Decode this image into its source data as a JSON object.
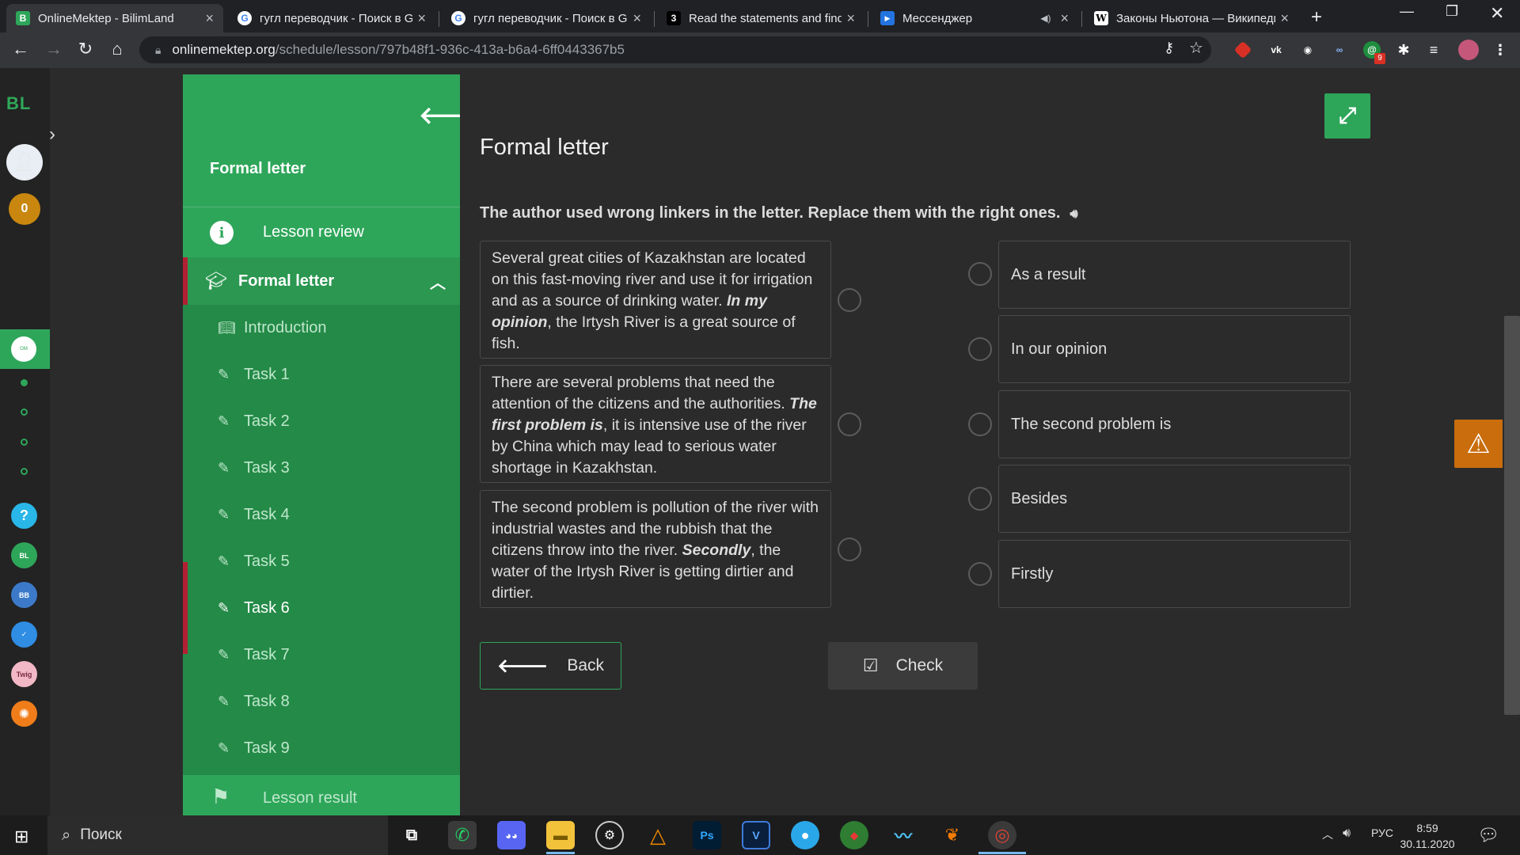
{
  "browser": {
    "tabs": [
      {
        "title": "OnlineMektep - BilimLand",
        "favicon": "B"
      },
      {
        "title": "гугл переводчик - Поиск в Google",
        "favicon": "G"
      },
      {
        "title": "гугл переводчик - Поиск в Google",
        "favicon": "G"
      },
      {
        "title": "Read the statements and find",
        "favicon": "3"
      },
      {
        "title": "Мессенджер",
        "favicon": "▶"
      },
      {
        "title": "Законы Ньютона — Википедия",
        "favicon": "W"
      }
    ],
    "url_domain": "onlinemektep.org",
    "url_path": "/schedule/lesson/797b48f1-936c-413a-b6a4-6ff0443367b5",
    "extension_badge": "9"
  },
  "rail": {
    "logo": "BL",
    "coins": "0"
  },
  "sidebar": {
    "title": "Formal letter",
    "review_label": "Lesson review",
    "section_label": "Formal letter",
    "items": [
      {
        "label": "Introduction"
      },
      {
        "label": "Task 1"
      },
      {
        "label": "Task 2"
      },
      {
        "label": "Task 3"
      },
      {
        "label": "Task 4"
      },
      {
        "label": "Task 5"
      },
      {
        "label": "Task 6"
      },
      {
        "label": "Task 7"
      },
      {
        "label": "Task 8"
      },
      {
        "label": "Task 9"
      }
    ],
    "result_label": "Lesson result"
  },
  "main": {
    "title": "Formal letter",
    "instruction": "The author used wrong linkers in the letter. Replace them with the right ones.",
    "left_items": [
      {
        "before": "Several great cities of Kazakhstan are located on this fast-moving river and use it for irrigation and as a source of drinking water. ",
        "emph": "In my opinion",
        "after": ", the Irtysh River is a great source of fish."
      },
      {
        "before": "There are several problems that need the attention of the citizens and the authorities. ",
        "emph": "The first problem is",
        "after": ", it is intensive use of the river by China which may lead to serious water shortage in Kazakhstan."
      },
      {
        "before": "The second problem is pollution of the river with industrial wastes and the rubbish that the citizens throw into the river. ",
        "emph": "Secondly",
        "after": ", the water of the Irtysh River is getting dirtier and dirtier."
      }
    ],
    "right_items": [
      {
        "label": "As a result"
      },
      {
        "label": "In our opinion"
      },
      {
        "label": "The second problem is"
      },
      {
        "label": "Besides"
      },
      {
        "label": "Firstly"
      }
    ],
    "back_label": "Back",
    "check_label": "Check"
  },
  "taskbar": {
    "search_placeholder": "Поиск",
    "language": "РУС",
    "time": "8:59",
    "date": "30.11.2020"
  },
  "colors": {
    "brand_green": "#2ea65a",
    "accent_red": "#b32034",
    "warning_orange": "#c96d0d"
  }
}
